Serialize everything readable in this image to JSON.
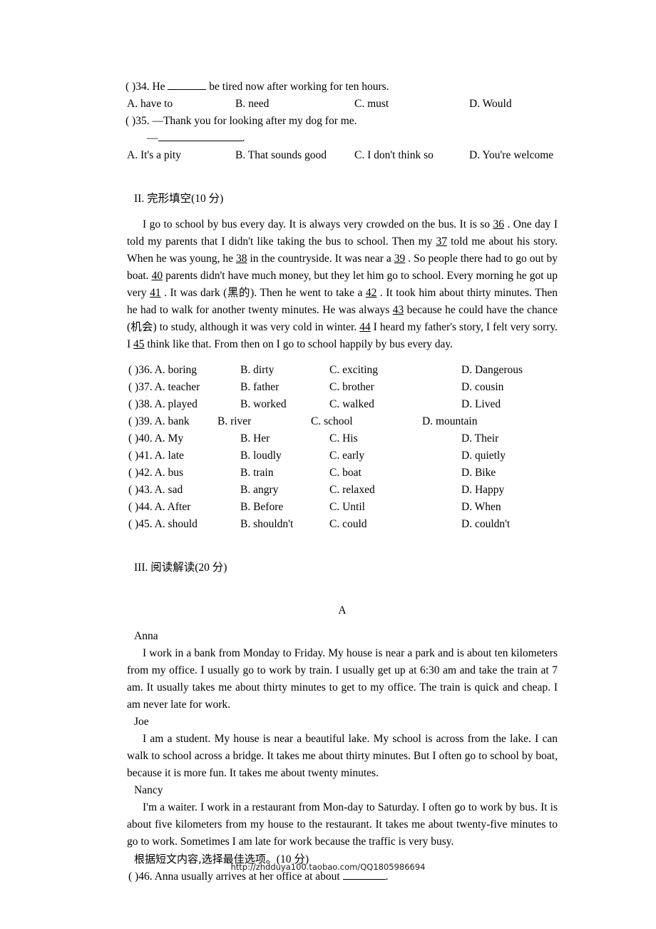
{
  "page": {
    "footer_url": "http://zhdduya100.taobao.com/QQ1805986694"
  },
  "grammar": {
    "q34": {
      "stem_pre": "( )34. He",
      "stem_post": "be tired now after working for ten hours.",
      "options": [
        "A. have to",
        "B. need",
        "C. must",
        "D. Would"
      ]
    },
    "q35": {
      "stem": "( )35. —Thank you for looking after my dog for me.",
      "reply_dash": "—",
      "reply_end": ".",
      "options": [
        "A. It's a pity",
        "B. That sounds good",
        "C. I don't think so",
        "D. You're welcome"
      ]
    }
  },
  "section2": {
    "heading_roman": "II.",
    "heading_cn": "完形填空",
    "heading_score": "(10 分)",
    "passage": {
      "p1_a": "I go to school by bus every day. It is always very crowded on the bus. It is so",
      "n36": "36",
      "p1_b": ". One day I told my parents that I didn't like taking the bus to school. Then my",
      "n37": "37",
      "p1_c": "told me about his story. When he was young, he",
      "n38": "38",
      "p1_d": "in the countryside. It was near a",
      "n39": "39",
      "p1_e": ". So people there had to go out by boat.",
      "n40": "40",
      "p1_f": "parents didn't have much money, but they let him go to school. Every morning he got up very",
      "n41": "41",
      "p1_g": ". It was dark (黑的). Then he went to take a",
      "n42": "42",
      "p1_h": ". It took him about thirty minutes. Then he had to walk for another twenty minutes. He was always",
      "n43": "43",
      "p1_i": "because he could have the chance (机会) to study, although it was very cold in winter.",
      "n44": "44",
      "p1_j": "I heard my father's story, I felt very sorry. I",
      "n45": "45",
      "p1_k": "think like that. From then on I go to school happily by bus every day."
    },
    "questions": [
      {
        "stem": "( )36. A. boring",
        "b": "B. dirty",
        "c": "C. exciting",
        "d": "D. Dangerous"
      },
      {
        "stem": "( )37. A. teacher",
        "b": "B. father",
        "c": "C. brother",
        "d": "D. cousin"
      },
      {
        "stem": "( )38. A. played",
        "b": "B. worked",
        "c": "C. walked",
        "d": "D. Lived"
      },
      {
        "stem": "( )39. A. bank",
        "b": "B. river",
        "c": "C. school",
        "d": "D. mountain"
      },
      {
        "stem": "( )40. A. My",
        "b": "B. Her",
        "c": "C. His",
        "d": "D. Their"
      },
      {
        "stem": "( )41. A. late",
        "b": "B. loudly",
        "c": "C. early",
        "d": "D. quietly"
      },
      {
        "stem": "( )42. A. bus",
        "b": "B. train",
        "c": "C. boat",
        "d": "D. Bike"
      },
      {
        "stem": "( )43. A. sad",
        "b": "B. angry",
        "c": "C. relaxed",
        "d": "D. Happy"
      },
      {
        "stem": "( )44. A. After",
        "b": "B. Before",
        "c": "C. Until",
        "d": "D. When"
      },
      {
        "stem": "( )45. A. should",
        "b": "B. shouldn't",
        "c": "C. could",
        "d": "D. couldn't"
      }
    ]
  },
  "section3": {
    "heading_roman": "III.",
    "heading_cn": "阅读解读",
    "heading_score": "(20 分)",
    "passage_label": "A",
    "people": [
      {
        "name": "Anna",
        "text": "I work in a bank from Monday to Friday. My house is near a park and is about ten kilometers from my office. I usually go to work by train. I usually get up at 6:30 am and take the train at 7 am. It usually takes me about thirty minutes to get to my office. The train is quick and cheap. I am never late for work."
      },
      {
        "name": "Joe",
        "text": "I am a student. My house is near a beautiful lake. My school is across from the lake. I can walk to school across a bridge. It takes me about thirty minutes. But I often go to school by boat, because it is more fun. It takes me about twenty minutes."
      },
      {
        "name": "Nancy",
        "text": "I'm a waiter. I work in a restaurant from Mon-day to Saturday. I often go to work by bus. It is about five kilometers from my house to the restaurant. It takes me about twenty-five minutes to go to work. Sometimes I am late for work because the traffic is very busy."
      }
    ],
    "instruction_cn": "根据短文内容,选择最佳选项。",
    "instruction_score": "(10 分)",
    "q46_pre": "( )46. Anna usually arrives at her office at about",
    "q46_post": "."
  }
}
